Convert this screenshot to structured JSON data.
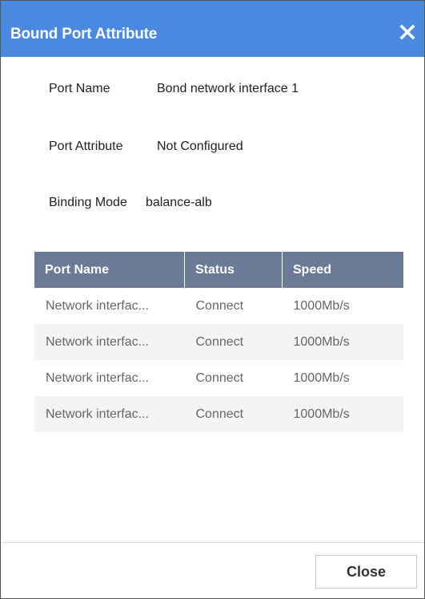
{
  "dialog": {
    "title": "Bound Port Attribute",
    "close_icon": "close-icon"
  },
  "fields": [
    {
      "label": "Port Name",
      "value": "Bond network interface 1"
    },
    {
      "label": "Port Attribute",
      "value": "Not Configured"
    },
    {
      "label": "Binding Mode",
      "value": "balance-alb"
    }
  ],
  "table": {
    "headers": [
      "Port Name",
      "Status",
      "Speed"
    ],
    "rows": [
      [
        "Network interfac...",
        "Connect",
        "1000Mb/s"
      ],
      [
        "Network interfac...",
        "Connect",
        "1000Mb/s"
      ],
      [
        "Network interfac...",
        "Connect",
        "1000Mb/s"
      ],
      [
        "Network interfac...",
        "Connect",
        "1000Mb/s"
      ]
    ]
  },
  "footer": {
    "close_label": "Close"
  },
  "colors": {
    "titlebar": "#4a89e0",
    "table_header": "#6b7a96",
    "stripe": "#f4f4f4"
  }
}
